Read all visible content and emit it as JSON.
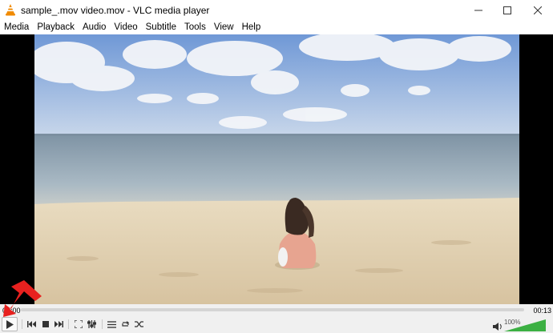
{
  "window": {
    "title": "sample_.mov video.mov - VLC media player",
    "minimize_icon": "minimize-icon",
    "maximize_icon": "maximize-icon",
    "close_icon": "close-icon"
  },
  "menu": {
    "items": [
      "Media",
      "Playback",
      "Audio",
      "Video",
      "Subtitle",
      "Tools",
      "View",
      "Help"
    ]
  },
  "player": {
    "elapsed": "00:00",
    "total": "00:13",
    "progress": 0.0,
    "volume_label": "100%",
    "volume_level": 1.0
  },
  "controls": {
    "play_icon": "play-icon",
    "prev_icon": "previous-icon",
    "stop_icon": "stop-icon",
    "next_icon": "next-icon",
    "fullscreen_icon": "fullscreen-icon",
    "extended_settings_icon": "extended-settings-icon",
    "playlist_icon": "playlist-icon",
    "loop_icon": "loop-icon",
    "shuffle_icon": "shuffle-icon",
    "volume_icon": "volume-icon"
  },
  "colors": {
    "accent_arrow": "#e8211f",
    "volume_green": "#3cb043",
    "vlc_orange": "#f08a00"
  }
}
